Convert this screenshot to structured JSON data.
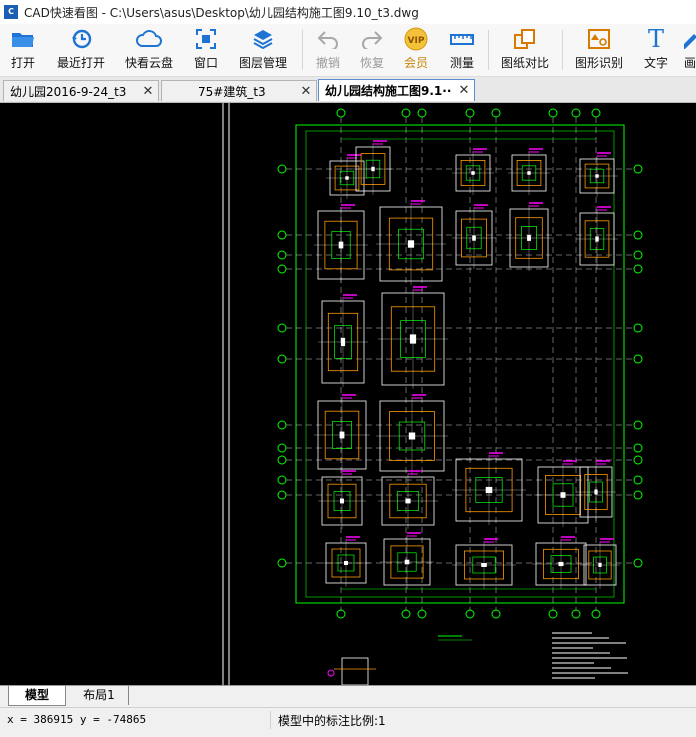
{
  "window": {
    "title": "CAD快速看图 - C:\\Users\\asus\\Desktop\\幼儿园结构施工图9.10_t3.dwg"
  },
  "toolbar": {
    "items": [
      {
        "label": "打开",
        "icon": "folder-open-icon"
      },
      {
        "label": "最近打开",
        "icon": "recent-clock-icon"
      },
      {
        "label": "快看云盘",
        "icon": "cloud-icon"
      },
      {
        "label": "窗口",
        "icon": "window-fit-icon"
      },
      {
        "label": "图层管理",
        "icon": "layers-icon"
      },
      {
        "label": "撤销",
        "icon": "undo-icon"
      },
      {
        "label": "恢复",
        "icon": "redo-icon"
      },
      {
        "label": "会员",
        "icon": "vip-badge-icon",
        "badge": "VIP"
      },
      {
        "label": "测量",
        "icon": "ruler-icon"
      },
      {
        "label": "图纸对比",
        "icon": "compare-icon"
      },
      {
        "label": "图形识别",
        "icon": "shape-recognition-icon"
      },
      {
        "label": "文字",
        "icon": "text-t-icon",
        "glyph": "T"
      },
      {
        "label": "画",
        "icon": "draw-icon"
      }
    ]
  },
  "tabs": [
    {
      "label": "幼儿园2016-9-24_t3",
      "close": "✕"
    },
    {
      "label": "75#建筑_t3",
      "close": "✕"
    },
    {
      "label": "幼儿园结构施工图9.1··",
      "close": "✕",
      "active": true
    }
  ],
  "layout_tabs": [
    {
      "label": "模型",
      "active": true
    },
    {
      "label": "布局1",
      "active": false
    }
  ],
  "status": {
    "coords": "x = 386915  y = -74865",
    "scale": "模型中的标注比例:1"
  },
  "colors": {
    "accent": "#1565c0",
    "grid_green": "#00ff00",
    "cad_white": "#ffffff",
    "cad_magenta": "#ff00ff",
    "cad_orange": "#ff9900",
    "canvas_bg": "#000000"
  }
}
